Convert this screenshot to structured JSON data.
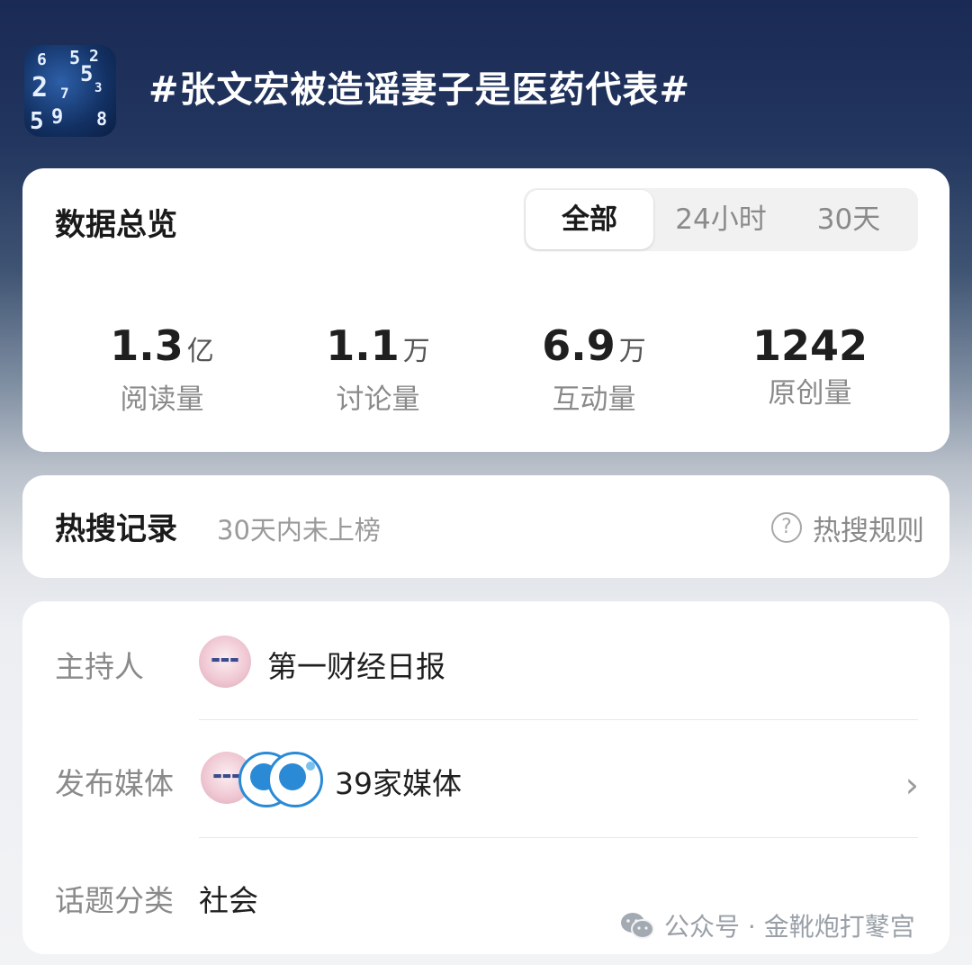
{
  "header": {
    "topic_title": "#张文宏被造谣妻子是医药代表#",
    "cover_icon": "topic-cover-image"
  },
  "overview": {
    "title": "数据总览",
    "tabs": [
      {
        "label": "全部",
        "active": true
      },
      {
        "label": "24小时",
        "active": false
      },
      {
        "label": "30天",
        "active": false
      }
    ],
    "stats": [
      {
        "value": "1.3",
        "unit": "亿",
        "label": "阅读量"
      },
      {
        "value": "1.1",
        "unit": "万",
        "label": "讨论量"
      },
      {
        "value": "6.9",
        "unit": "万",
        "label": "互动量"
      },
      {
        "value": "1242",
        "unit": "",
        "label": "原创量"
      }
    ]
  },
  "hot_search": {
    "title": "热搜记录",
    "subtitle": "30天内未上榜",
    "rule_label": "热搜规则",
    "rule_icon": "question-circle-icon"
  },
  "info": {
    "host_label": "主持人",
    "host_name": "第一财经日报",
    "media_label": "发布媒体",
    "media_count": "39家媒体",
    "category_label": "话题分类",
    "category_value": "社会"
  },
  "watermark": {
    "text": "公众号 · 金靴炮打鼕宫",
    "icon": "wechat-icon"
  },
  "colors": {
    "header_bg": "#1a2a55",
    "card_bg": "#ffffff",
    "muted_text": "#8a8a8a",
    "primary_text": "#1a1a1a"
  }
}
